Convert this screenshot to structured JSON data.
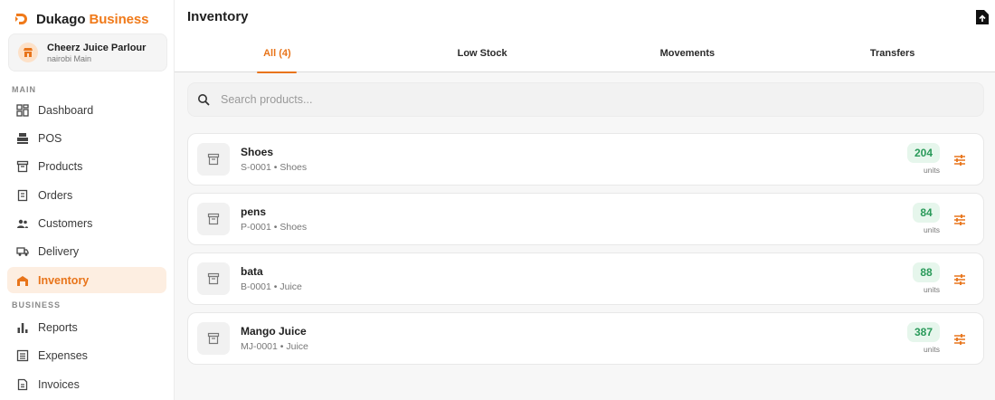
{
  "brand": {
    "name_part1": "Dukago",
    "name_part2": "Business"
  },
  "store": {
    "name": "Cheerz Juice Parlour",
    "branch": "nairobi Main"
  },
  "sidebar": {
    "sections": [
      {
        "label": "MAIN"
      },
      {
        "label": "BUSINESS"
      }
    ],
    "items": [
      {
        "label": "Dashboard",
        "icon": "dashboard-icon"
      },
      {
        "label": "POS",
        "icon": "pos-icon"
      },
      {
        "label": "Products",
        "icon": "products-icon"
      },
      {
        "label": "Orders",
        "icon": "orders-icon"
      },
      {
        "label": "Customers",
        "icon": "customers-icon"
      },
      {
        "label": "Delivery",
        "icon": "delivery-icon"
      },
      {
        "label": "Inventory",
        "icon": "inventory-icon",
        "active": true
      },
      {
        "label": "Reports",
        "icon": "reports-icon"
      },
      {
        "label": "Expenses",
        "icon": "expenses-icon"
      },
      {
        "label": "Invoices",
        "icon": "invoices-icon"
      }
    ]
  },
  "header": {
    "title": "Inventory"
  },
  "tabs": [
    {
      "label": "All (4)",
      "active": true
    },
    {
      "label": "Low Stock"
    },
    {
      "label": "Movements"
    },
    {
      "label": "Transfers"
    }
  ],
  "search": {
    "placeholder": "Search products...",
    "value": ""
  },
  "products": [
    {
      "name": "Shoes",
      "sub": "S-0001 • Shoes",
      "qty": "204",
      "unit": "units"
    },
    {
      "name": "pens",
      "sub": "P-0001 • Shoes",
      "qty": "84",
      "unit": "units"
    },
    {
      "name": "bata",
      "sub": "B-0001 • Juice",
      "qty": "88",
      "unit": "units"
    },
    {
      "name": "Mango Juice",
      "sub": "MJ-0001 • Juice",
      "qty": "387",
      "unit": "units"
    }
  ],
  "colors": {
    "accent": "#e8741a",
    "stock_text": "#2a9a5a",
    "stock_bg": "#e6f6ec"
  }
}
